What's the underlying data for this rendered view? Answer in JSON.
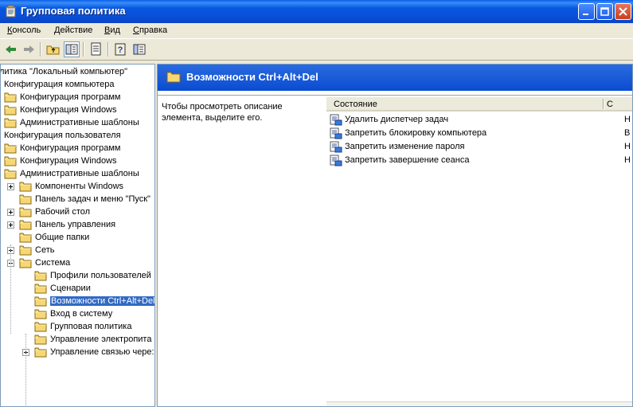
{
  "window": {
    "title": "Групповая политика",
    "icon": "group-policy-icon"
  },
  "menu": [
    {
      "label": "Консоль",
      "accel_index": 0
    },
    {
      "label": "Действие",
      "accel_index": 0
    },
    {
      "label": "Вид",
      "accel_index": 0
    },
    {
      "label": "Справка",
      "accel_index": 0
    }
  ],
  "toolbar": {
    "buttons": [
      "back-icon",
      "forward-icon",
      "up-folder-icon",
      "show-hide-tree-icon",
      "export-list-icon",
      "help-icon",
      "properties-icon"
    ]
  },
  "tree": {
    "items": [
      {
        "label": "литика \"Локальный компьютер\"",
        "level": 0
      },
      {
        "label": "Конфигурация компьютера",
        "level": 0
      },
      {
        "label": "Конфигурация программ",
        "level": 1
      },
      {
        "label": "Конфигурация Windows",
        "level": 1
      },
      {
        "label": "Административные шаблоны",
        "level": 1
      },
      {
        "label": "Конфигурация пользователя",
        "level": 0
      },
      {
        "label": "Конфигурация программ",
        "level": 1
      },
      {
        "label": "Конфигурация Windows",
        "level": 1
      },
      {
        "label": "Административные шаблоны",
        "level": 1
      },
      {
        "label": "Компоненты Windows",
        "level": 2,
        "expander": "plus"
      },
      {
        "label": "Панель задач и меню \"Пуск\"",
        "level": 2
      },
      {
        "label": "Рабочий стол",
        "level": 2,
        "expander": "plus"
      },
      {
        "label": "Панель управления",
        "level": 2,
        "expander": "plus"
      },
      {
        "label": "Общие папки",
        "level": 2
      },
      {
        "label": "Сеть",
        "level": 2,
        "expander": "plus"
      },
      {
        "label": "Система",
        "level": 2,
        "expander": "minus"
      },
      {
        "label": "Профили пользователей",
        "level": 3
      },
      {
        "label": "Сценарии",
        "level": 3
      },
      {
        "label": "Возможности Ctrl+Alt+Del",
        "level": 3,
        "selected": true
      },
      {
        "label": "Вход в систему",
        "level": 3
      },
      {
        "label": "Групповая политика",
        "level": 3
      },
      {
        "label": "Управление электропита",
        "level": 3
      },
      {
        "label": "Управление связью чере:",
        "level": 3,
        "expander": "plus"
      }
    ]
  },
  "details": {
    "title": "Возможности Ctrl+Alt+Del",
    "description": "Чтобы просмотреть описание элемента, выделите его.",
    "columns": [
      "Состояние",
      "С"
    ],
    "rows": [
      {
        "name": "Удалить диспетчер задач",
        "state": "Н"
      },
      {
        "name": "Запретить блокировку компьютера",
        "state": "В"
      },
      {
        "name": "Запретить изменение пароля",
        "state": "Н"
      },
      {
        "name": "Запретить завершение сеанса",
        "state": "Н"
      }
    ]
  },
  "colors": {
    "titlebar": "#0A50D8",
    "selection": "#316AC5",
    "folder": "#F7D774"
  }
}
